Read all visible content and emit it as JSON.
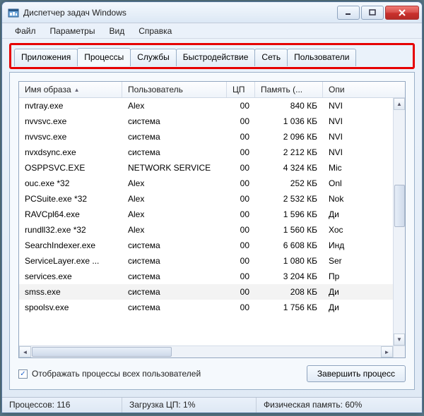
{
  "window": {
    "title": "Диспетчер задач Windows"
  },
  "menu": {
    "file": "Файл",
    "options": "Параметры",
    "view": "Вид",
    "help": "Справка"
  },
  "tabs": {
    "applications": "Приложения",
    "processes": "Процессы",
    "services": "Службы",
    "performance": "Быстродействие",
    "networking": "Сеть",
    "users": "Пользователи"
  },
  "columns": {
    "image": "Имя образа",
    "user": "Пользователь",
    "cpu": "ЦП",
    "memory": "Память (...",
    "desc": "Опи"
  },
  "rows": [
    {
      "img": "nvtray.exe",
      "user": "Alex",
      "cpu": "00",
      "mem": "840 КБ",
      "desc": "NVI"
    },
    {
      "img": "nvvsvc.exe",
      "user": "система",
      "cpu": "00",
      "mem": "1 036 КБ",
      "desc": "NVI"
    },
    {
      "img": "nvvsvc.exe",
      "user": "система",
      "cpu": "00",
      "mem": "2 096 КБ",
      "desc": "NVI"
    },
    {
      "img": "nvxdsync.exe",
      "user": "система",
      "cpu": "00",
      "mem": "2 212 КБ",
      "desc": "NVI"
    },
    {
      "img": "OSPPSVC.EXE",
      "user": "NETWORK SERVICE",
      "cpu": "00",
      "mem": "4 324 КБ",
      "desc": "Mic"
    },
    {
      "img": "ouc.exe *32",
      "user": "Alex",
      "cpu": "00",
      "mem": "252 КБ",
      "desc": "Onl"
    },
    {
      "img": "PCSuite.exe *32",
      "user": "Alex",
      "cpu": "00",
      "mem": "2 532 КБ",
      "desc": "Nok"
    },
    {
      "img": "RAVCpl64.exe",
      "user": "Alex",
      "cpu": "00",
      "mem": "1 596 КБ",
      "desc": "Ди"
    },
    {
      "img": "rundll32.exe *32",
      "user": "Alex",
      "cpu": "00",
      "mem": "1 560 КБ",
      "desc": "Хос"
    },
    {
      "img": "SearchIndexer.exe",
      "user": "система",
      "cpu": "00",
      "mem": "6 608 КБ",
      "desc": "Инд"
    },
    {
      "img": "ServiceLayer.exe ...",
      "user": "система",
      "cpu": "00",
      "mem": "1 080 КБ",
      "desc": "Ser"
    },
    {
      "img": "services.exe",
      "user": "система",
      "cpu": "00",
      "mem": "3 204 КБ",
      "desc": "Пр"
    },
    {
      "img": "smss.exe",
      "user": "система",
      "cpu": "00",
      "mem": "208 КБ",
      "desc": "Ди"
    },
    {
      "img": "spoolsv.exe",
      "user": "система",
      "cpu": "00",
      "mem": "1 756 КБ",
      "desc": "Ди"
    }
  ],
  "footer": {
    "show_all_label": "Отображать процессы всех пользователей",
    "end_process": "Завершить процесс"
  },
  "status": {
    "processes": "Процессов: 116",
    "cpu": "Загрузка ЦП: 1%",
    "mem": "Физическая память: 60%"
  }
}
